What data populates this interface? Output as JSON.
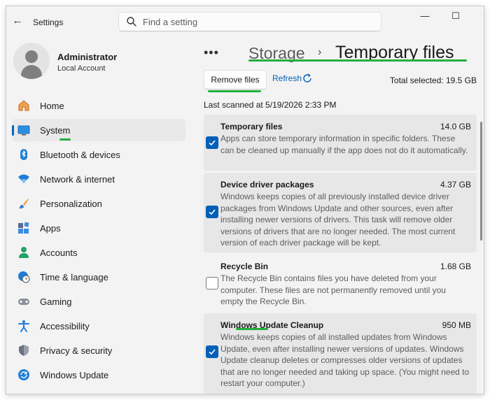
{
  "app": {
    "title": "Settings",
    "back_icon": "back-arrow-icon",
    "window_controls": {
      "minimize": "—",
      "maximize": "☐"
    }
  },
  "search": {
    "placeholder": "Find a setting",
    "value": ""
  },
  "profile": {
    "name": "Administrator",
    "account_type": "Local Account"
  },
  "sidebar": {
    "items": [
      {
        "label": "Home",
        "icon": "home-icon"
      },
      {
        "label": "System",
        "icon": "system-icon",
        "selected": true
      },
      {
        "label": "Bluetooth & devices",
        "icon": "bluetooth-icon"
      },
      {
        "label": "Network & internet",
        "icon": "wifi-icon"
      },
      {
        "label": "Personalization",
        "icon": "brush-icon"
      },
      {
        "label": "Apps",
        "icon": "apps-icon"
      },
      {
        "label": "Accounts",
        "icon": "accounts-icon"
      },
      {
        "label": "Time & language",
        "icon": "globe-clock-icon"
      },
      {
        "label": "Gaming",
        "icon": "gamepad-icon"
      },
      {
        "label": "Accessibility",
        "icon": "accessibility-icon"
      },
      {
        "label": "Privacy & security",
        "icon": "shield-icon"
      },
      {
        "label": "Windows Update",
        "icon": "windows-update-icon"
      }
    ]
  },
  "breadcrumb": {
    "overflow": "•••",
    "parent": "Storage",
    "separator": "›",
    "current": "Temporary files"
  },
  "toolbar": {
    "remove_label": "Remove files",
    "refresh_label": "Refresh",
    "total_selected": "Total selected: 19.5 GB"
  },
  "scan": {
    "last_scanned": "Last scanned at 5/19/2026 2:33 PM"
  },
  "items": [
    {
      "title": "Temporary files",
      "size": "14.0 GB",
      "checked": true,
      "description": "Apps can store temporary information in specific folders. These can be cleaned up manually if the app does not do it automatically."
    },
    {
      "title": "Device driver packages",
      "size": "4.37 GB",
      "checked": true,
      "description": "Windows keeps copies of all previously installed device driver packages from Windows Update and other sources, even after installing newer versions of drivers. This task will remove older versions of drivers that are no longer needed. The most current version of each driver package will be kept."
    },
    {
      "title": "Recycle Bin",
      "size": "1.68 GB",
      "checked": false,
      "description": "The Recycle Bin contains files you have deleted from your computer. These files are not permanently removed until you empty the Recycle Bin."
    },
    {
      "title": "Windows Update Cleanup",
      "size": "950 MB",
      "checked": true,
      "description": "Windows keeps copies of all installed updates from Windows Update, even after installing newer versions of updates. Windows Update cleanup deletes or compresses older versions of updates that are no longer needed and taking up space. (You might need to restart your computer.)"
    }
  ],
  "colors": {
    "accent": "#005fb8",
    "annotation_green": "#22b03c",
    "window_bg": "#f3f3f3",
    "card_bg": "#e7e7e7"
  }
}
